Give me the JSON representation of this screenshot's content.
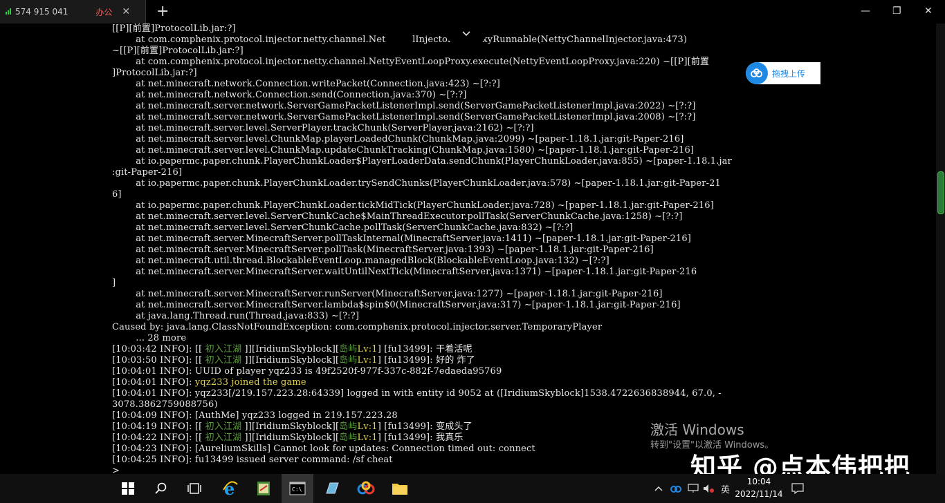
{
  "titlebar": {
    "signal_icon": "signal-bars-icon",
    "session_id": "574 915 041",
    "session_tag": "办公",
    "close": "✕",
    "newtab": "+",
    "minimize": "—",
    "restore": "❐",
    "close_window": "✕"
  },
  "collapse_icon": "chevron-down-icon",
  "upload_label": "拖拽上传",
  "terminal": {
    "prompt": ">",
    "stack_lines": [
      "[[P][前置]ProtocolLib.jar:?]",
      "        at com.comphenix.protocol.injector.netty.channel.Net         lInjector$2.proxyRunnable(NettyChannelInjector.java:473)",
      "~[[P][前置]ProtocolLib.jar:?]",
      "        at com.comphenix.protocol.injector.netty.channel.NettyEventLoopProxy.execute(NettyEventLoopProxy.java:220) ~[[P][前置",
      "]ProtocolLib.jar:?]",
      "        at net.minecraft.network.Connection.writePacket(Connection.java:423) ~[?:?]",
      "        at net.minecraft.network.Connection.send(Connection.java:370) ~[?:?]",
      "        at net.minecraft.server.network.ServerGamePacketListenerImpl.send(ServerGamePacketListenerImpl.java:2022) ~[?:?]",
      "        at net.minecraft.server.network.ServerGamePacketListenerImpl.send(ServerGamePacketListenerImpl.java:2008) ~[?:?]",
      "        at net.minecraft.server.level.ServerPlayer.trackChunk(ServerPlayer.java:2162) ~[?:?]",
      "        at net.minecraft.server.level.ChunkMap.playerLoadedChunk(ChunkMap.java:2099) ~[paper-1.18.1.jar:git-Paper-216]",
      "        at net.minecraft.server.level.ChunkMap.updateChunkTracking(ChunkMap.java:1580) ~[paper-1.18.1.jar:git-Paper-216]",
      "        at io.papermc.paper.chunk.PlayerChunkLoader$PlayerLoaderData.sendChunk(PlayerChunkLoader.java:855) ~[paper-1.18.1.jar",
      ":git-Paper-216]",
      "        at io.papermc.paper.chunk.PlayerChunkLoader.trySendChunks(PlayerChunkLoader.java:578) ~[paper-1.18.1.jar:git-Paper-21",
      "6]",
      "        at io.papermc.paper.chunk.PlayerChunkLoader.tickMidTick(PlayerChunkLoader.java:728) ~[paper-1.18.1.jar:git-Paper-216]",
      "        at net.minecraft.server.level.ServerChunkCache$MainThreadExecutor.pollTask(ServerChunkCache.java:1258) ~[?:?]",
      "        at net.minecraft.server.level.ServerChunkCache.pollTask(ServerChunkCache.java:832) ~[?:?]",
      "        at net.minecraft.server.MinecraftServer.pollTaskInternal(MinecraftServer.java:1411) ~[paper-1.18.1.jar:git-Paper-216]",
      "        at net.minecraft.server.MinecraftServer.pollTask(MinecraftServer.java:1393) ~[paper-1.18.1.jar:git-Paper-216]",
      "        at net.minecraft.util.thread.BlockableEventLoop.managedBlock(BlockableEventLoop.java:132) ~[?:?]",
      "        at net.minecraft.server.MinecraftServer.waitUntilNextTick(MinecraftServer.java:1371) ~[paper-1.18.1.jar:git-Paper-216",
      "]",
      "        at net.minecraft.server.MinecraftServer.runServer(MinecraftServer.java:1277) ~[paper-1.18.1.jar:git-Paper-216]",
      "        at net.minecraft.server.MinecraftServer.lambda$spin$0(MinecraftServer.java:317) ~[paper-1.18.1.jar:git-Paper-216]",
      "        at java.lang.Thread.run(Thread.java:833) ~[?:?]",
      "Caused by: java.lang.ClassNotFoundException: com.comphenix.protocol.injector.server.TemporaryPlayer",
      "        ... 28 more"
    ],
    "log_lines": [
      {
        "pre": "[10:03:42 INFO]: [[ ",
        "rank": "初入江湖",
        "mid": " ]][IridiumSkyblock][",
        "island": "岛屿",
        "lv": "Lv:1",
        "post": "] [fu13499]: 干着活呢"
      },
      {
        "pre": "[10:03:50 INFO]: [[ ",
        "rank": "初入江湖",
        "mid": " ]][IridiumSkyblock][",
        "island": "岛屿",
        "lv": "Lv:1",
        "post": "] [fu13499]: 好的 炸了"
      },
      {
        "text": "[10:04:01 INFO]: UUID of player yqz233 is 49f2520f-977f-337c-882f-7edaeda95769"
      },
      {
        "pre": "[10:04:01 INFO]: ",
        "join": "yqz233 joined the game"
      },
      {
        "text": "[10:04:01 INFO]: yqz233[/219.157.223.28:64339] logged in with entity id 9052 at ([IridiumSkyblock]1538.4722636838944, 67.0, -"
      },
      {
        "text": "3078.3862759088756)"
      },
      {
        "text": "[10:04:09 INFO]: [AuthMe] yqz233 logged in 219.157.223.28"
      },
      {
        "pre": "[10:04:19 INFO]: [[ ",
        "rank": "初入江湖",
        "mid": " ]][IridiumSkyblock][",
        "island": "岛屿",
        "lv": "Lv:1",
        "post": "] [fu13499]: 变成头了"
      },
      {
        "pre": "[10:04:22 INFO]: [[ ",
        "rank": "初入江湖",
        "mid": " ]][IridiumSkyblock][",
        "island": "岛屿",
        "lv": "Lv:1",
        "post": "] [fu13499]: 我真乐"
      },
      {
        "text": "[10:04:23 INFO]: [AureliumSkills] Cannot look for updates: Connection timed out: connect"
      },
      {
        "text": "[10:04:25 INFO]: fu13499 issued server command: /sf cheat"
      }
    ]
  },
  "watermark": {
    "line1": "激活 Windows",
    "line2": "转到\"设置\"以激活 Windows。",
    "zhihu": "知乎 @点本伟把把"
  },
  "taskbar": {
    "apps": [
      {
        "name": "start-button",
        "icon": "windows-logo-icon"
      },
      {
        "name": "search-button",
        "icon": "search-icon"
      },
      {
        "name": "task-view-button",
        "icon": "task-view-icon"
      },
      {
        "name": "ie-button",
        "icon": "internet-explorer-icon"
      },
      {
        "name": "notepad-button",
        "icon": "notepad-icon"
      },
      {
        "name": "cmd-button",
        "icon": "terminal-icon"
      },
      {
        "name": "folder-app-button",
        "icon": "app-icon"
      },
      {
        "name": "baidu-cloud-button",
        "icon": "cloud-icon"
      },
      {
        "name": "file-explorer-button",
        "icon": "folder-icon"
      }
    ],
    "tray_ime": "英",
    "time": "10:04",
    "date": "2022/11/14"
  },
  "colors": {
    "rank": "#5a9e3a",
    "join": "#e0d050",
    "upload_accent": "#1e88e5"
  }
}
